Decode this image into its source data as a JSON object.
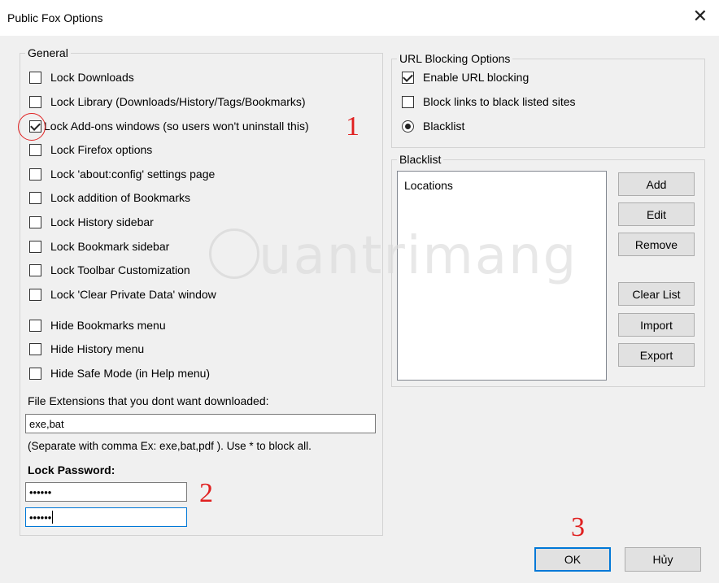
{
  "window": {
    "title": "Public Fox Options",
    "close_glyph": "✕"
  },
  "general": {
    "legend": "General",
    "options": [
      {
        "label": "Lock Downloads",
        "checked": false
      },
      {
        "label": "Lock Library (Downloads/History/Tags/Bookmarks)",
        "checked": false
      },
      {
        "label": "Lock Add-ons windows (so users won't uninstall this)",
        "checked": true
      },
      {
        "label": "Lock Firefox options",
        "checked": false
      },
      {
        "label": "Lock 'about:config' settings page",
        "checked": false
      },
      {
        "label": "Lock addition of Bookmarks",
        "checked": false
      },
      {
        "label": "Lock History sidebar",
        "checked": false
      },
      {
        "label": "Lock Bookmark sidebar",
        "checked": false
      },
      {
        "label": "Lock Toolbar Customization",
        "checked": false
      },
      {
        "label": "Lock 'Clear Private Data' window",
        "checked": false
      },
      {
        "label": "Hide Bookmarks menu",
        "checked": false
      },
      {
        "label": "Hide History menu",
        "checked": false
      },
      {
        "label": "Hide Safe Mode (in Help menu)",
        "checked": false
      }
    ],
    "extensions_label": "File Extensions that you dont want downloaded:",
    "extensions_value": "exe,bat",
    "extensions_hint": "(Separate with comma Ex: exe,bat,pdf ). Use * to block all.",
    "password_label": "Lock Password:",
    "password_value": "••••••",
    "password_confirm_value": "••••••"
  },
  "url_blocking": {
    "legend": "URL Blocking Options",
    "enable_label": "Enable URL blocking",
    "enable_checked": true,
    "block_links_label": "Block links to black listed sites",
    "block_links_checked": false,
    "blacklist_radio_label": "Blacklist",
    "blacklist_radio_selected": true
  },
  "blacklist": {
    "legend": "Blacklist",
    "column_header": "Locations",
    "buttons": {
      "add": "Add",
      "edit": "Edit",
      "remove": "Remove",
      "clear": "Clear List",
      "import": "Import",
      "export": "Export"
    }
  },
  "footer": {
    "ok": "OK",
    "cancel": "Hủy"
  },
  "annotations": {
    "marker1": "1",
    "marker2": "2",
    "marker3": "3",
    "color": "#e02020"
  },
  "watermark": {
    "text": "uantrimang"
  }
}
